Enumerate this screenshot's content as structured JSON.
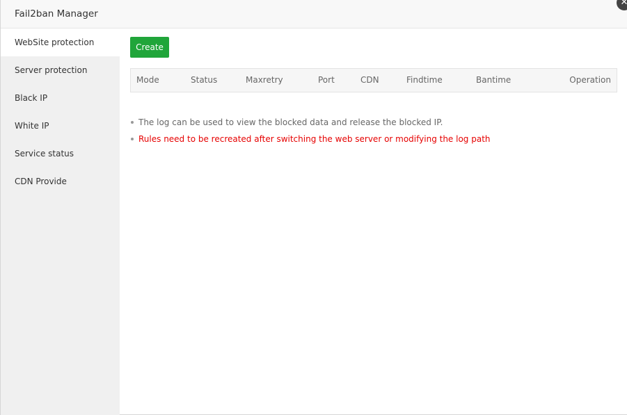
{
  "window": {
    "title": "Fail2ban Manager",
    "close_glyph": "✕"
  },
  "sidebar": {
    "items": [
      {
        "label": "WebSite protection",
        "active": true
      },
      {
        "label": "Server protection",
        "active": false
      },
      {
        "label": "Black IP",
        "active": false
      },
      {
        "label": "White IP",
        "active": false
      },
      {
        "label": "Service status",
        "active": false
      },
      {
        "label": "CDN Provide",
        "active": false
      }
    ]
  },
  "toolbar": {
    "create_label": "Create"
  },
  "table": {
    "columns": [
      "Mode",
      "Status",
      "Maxretry",
      "Port",
      "CDN",
      "Findtime",
      "Bantime",
      "Operation"
    ],
    "rows": []
  },
  "notes": [
    {
      "text": "The log can be used to view the blocked data and release the blocked IP.",
      "color": "#666666"
    },
    {
      "text": "Rules need to be recreated after switching the web server or modifying the log path",
      "color": "#e60000"
    }
  ],
  "colors": {
    "accent": "#20a53a",
    "warning": "#e60000"
  }
}
